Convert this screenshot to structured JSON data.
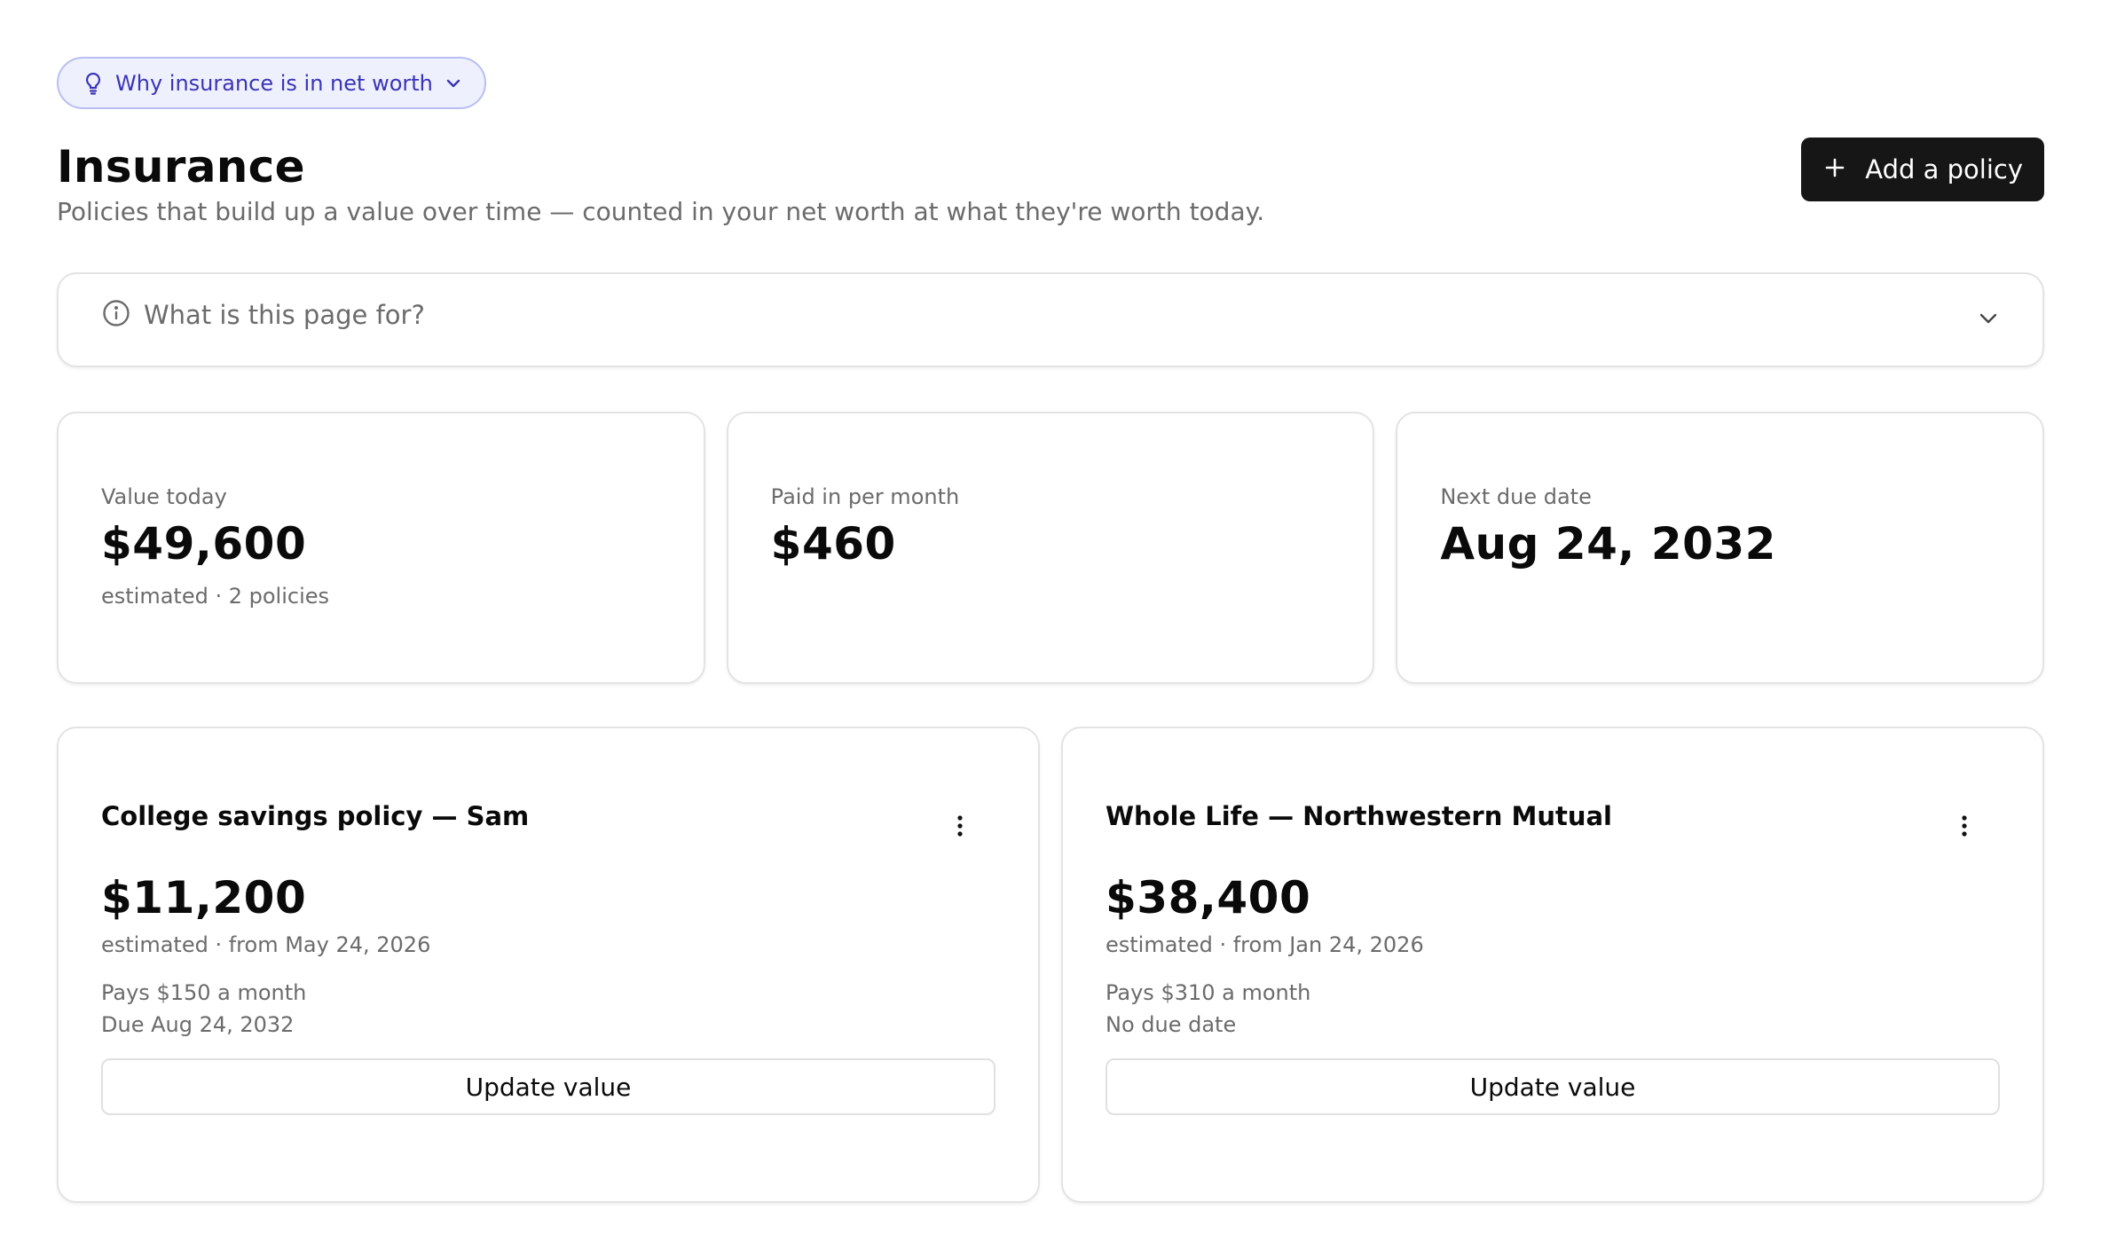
{
  "hint": {
    "label": "Why insurance is in net worth"
  },
  "header": {
    "title": "Insurance",
    "subtitle": "Policies that build up a value over time — counted in your net worth at what they're worth today.",
    "add_button_label": "Add a policy"
  },
  "faq": {
    "label": "What is this page for?"
  },
  "stats": [
    {
      "label": "Value today",
      "value": "$49,600",
      "sub": "estimated · 2 policies"
    },
    {
      "label": "Paid in per month",
      "value": "$460",
      "sub": ""
    },
    {
      "label": "Next due date",
      "value": "Aug 24, 2032",
      "sub": ""
    }
  ],
  "policies": [
    {
      "title": "College savings policy — Sam",
      "value": "$11,200",
      "meta": "estimated · from May 24, 2026",
      "pays": "Pays $150 a month",
      "due": "Due Aug 24, 2032",
      "button_label": "Update value"
    },
    {
      "title": "Whole Life — Northwestern Mutual",
      "value": "$38,400",
      "meta": "estimated · from Jan 24, 2026",
      "pays": "Pays $310 a month",
      "due": "No due date",
      "button_label": "Update value"
    }
  ],
  "icons": {
    "hint": "lightbulb-icon",
    "hint_toggle": "chevron-down-icon",
    "add": "plus-icon",
    "faq": "info-icon",
    "faq_toggle": "chevron-down-icon",
    "policy_menu": "more-vertical-icon"
  },
  "colors": {
    "accent": "#3b33b8",
    "accent_bg": "#eef0fd",
    "accent_border": "#b9bef2",
    "primary_button": "#161616",
    "muted_text": "#6b6b6b",
    "card_border": "#e3e3e3"
  }
}
